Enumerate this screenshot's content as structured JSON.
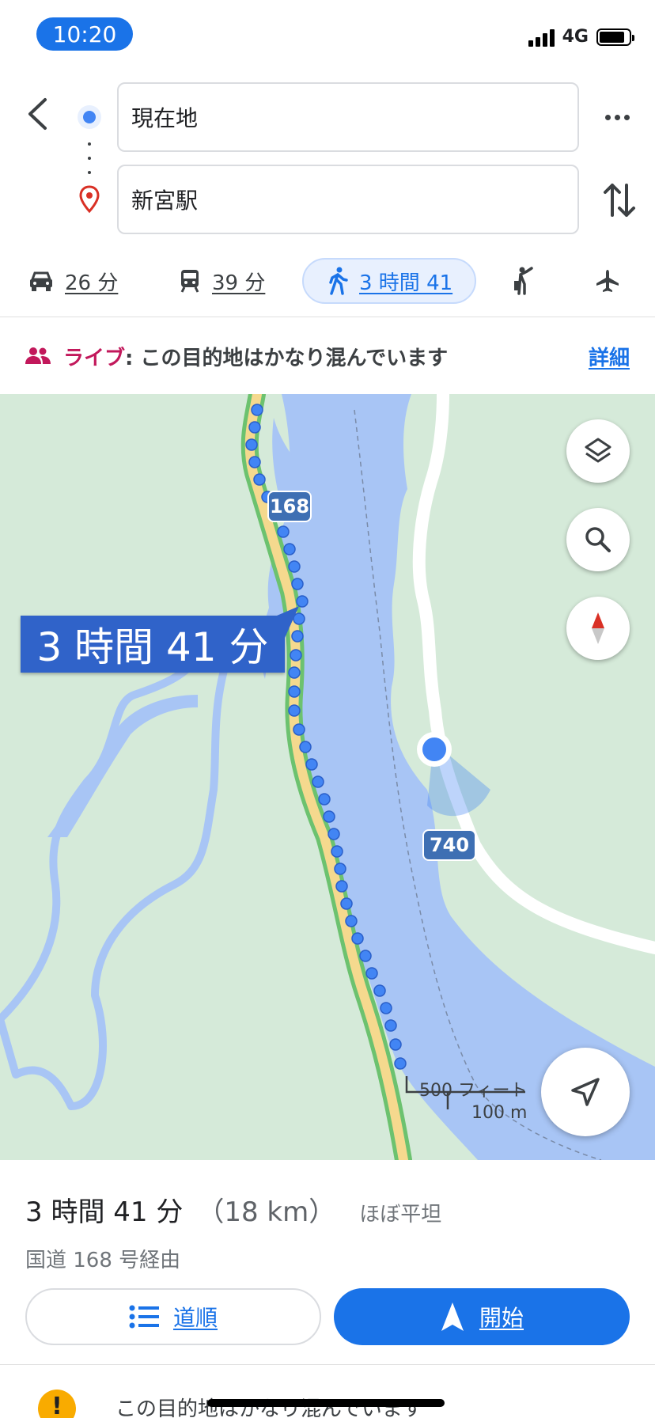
{
  "status_bar": {
    "time": "10:20",
    "network": "4G",
    "battery_level": 0.85
  },
  "route": {
    "origin_label": "現在地",
    "destination_label": "新宮駅"
  },
  "modes": [
    {
      "name": "drive",
      "icon": "car-icon",
      "label": "26 分"
    },
    {
      "name": "transit",
      "icon": "train-icon",
      "label": "39 分"
    },
    {
      "name": "walk",
      "icon": "walk-icon",
      "label": "3 時間 41",
      "selected": true
    },
    {
      "name": "ride",
      "icon": "ride-hail-icon",
      "label": ""
    },
    {
      "name": "flight",
      "icon": "airplane-icon",
      "label": ""
    }
  ],
  "live_banner": {
    "tag": "ライブ",
    "separator": ": ",
    "message": "この目的地はかなり混んでいます",
    "detail_link": "詳細"
  },
  "map": {
    "eta_label": "3 時間 41 分",
    "route_shield": "168",
    "road_shield": "740",
    "scale_top": "500 フィート",
    "scale_bottom": "100 m",
    "buttons": [
      "layers-icon",
      "search-icon",
      "compass-icon",
      "location-arrow-icon"
    ]
  },
  "summary": {
    "duration": "3 時間 41 分",
    "distance": "（18 km）",
    "terrain": "ほぼ平坦",
    "via": "国道 168 号経由",
    "steps_button": "道順",
    "start_button": "開始",
    "notice_icon": "!",
    "notice_text": "この目的地はかなり混んでいます"
  },
  "colors": {
    "accent": "#1a73e8",
    "live_tag": "#c2185b",
    "map_land": "#d5ead9",
    "map_water": "#a8c5f5",
    "route_green": "#6cc26f",
    "route_fill": "#f5d98e",
    "route_dots": "#4285f4"
  }
}
